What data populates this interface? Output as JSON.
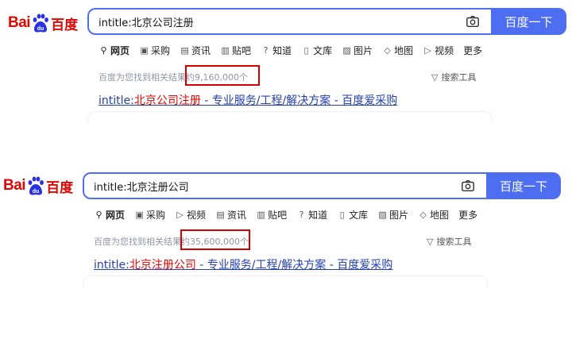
{
  "brand": {
    "logo_latin": "Bai",
    "logo_cn": "百度"
  },
  "panels": [
    {
      "search": {
        "query": "intitle:北京公司注册",
        "button_label": "百度一下"
      },
      "tabs": [
        {
          "label": "网页",
          "icon": "search-icon",
          "active": true
        },
        {
          "label": "采购",
          "icon": "shopping-icon"
        },
        {
          "label": "资讯",
          "icon": "news-icon"
        },
        {
          "label": "贴吧",
          "icon": "tieba-icon"
        },
        {
          "label": "知道",
          "icon": "question-icon"
        },
        {
          "label": "文库",
          "icon": "document-icon"
        },
        {
          "label": "图片",
          "icon": "image-icon"
        },
        {
          "label": "地图",
          "icon": "map-icon"
        },
        {
          "label": "视频",
          "icon": "video-icon"
        },
        {
          "label": "更多",
          "icon": ""
        }
      ],
      "stats": {
        "prefix": "百度为您找到相关结果约",
        "count": "9,160,000个"
      },
      "tools": {
        "label": "搜索工具",
        "icon": "filter-icon"
      },
      "result": {
        "lead": "intitle:",
        "keyword": "北京公司注册",
        "rest": " - 专业服务/工程/解决方案 - 百度爱采购"
      }
    },
    {
      "search": {
        "query": "intitle:北京注册公司",
        "button_label": "百度一下"
      },
      "tabs": [
        {
          "label": "网页",
          "icon": "search-icon",
          "active": true
        },
        {
          "label": "采购",
          "icon": "shopping-icon"
        },
        {
          "label": "视频",
          "icon": "video-icon"
        },
        {
          "label": "资讯",
          "icon": "news-icon"
        },
        {
          "label": "贴吧",
          "icon": "tieba-icon"
        },
        {
          "label": "知道",
          "icon": "question-icon"
        },
        {
          "label": "文库",
          "icon": "document-icon"
        },
        {
          "label": "图片",
          "icon": "image-icon"
        },
        {
          "label": "地图",
          "icon": "map-icon"
        },
        {
          "label": "更多",
          "icon": ""
        }
      ],
      "stats": {
        "prefix": "百度为您找到相关结果约",
        "count": "35,600,000个"
      },
      "tools": {
        "label": "搜索工具",
        "icon": "filter-icon"
      },
      "result": {
        "lead": "intitle:",
        "keyword": "北京注册公司",
        "rest": " - 专业服务/工程/解决方案 - 百度爱采购"
      }
    }
  ],
  "colors": {
    "brand_red": "#e10602",
    "accent_blue": "#4e6ef2",
    "link_blue": "#2440b3",
    "highlight_box": "#d40000"
  }
}
